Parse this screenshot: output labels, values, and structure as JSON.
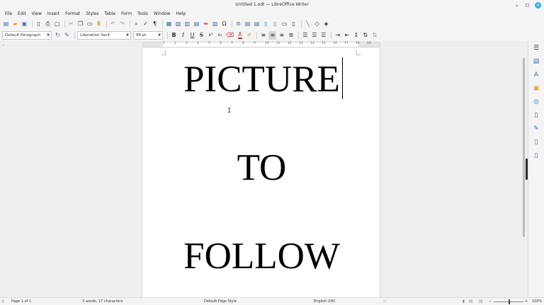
{
  "window": {
    "title": "Untitled 1.odt — LibreOffice Writer",
    "minimize": "⌄",
    "maximize": "◻",
    "close": "✕"
  },
  "menu": [
    "File",
    "Edit",
    "View",
    "Insert",
    "Format",
    "Styles",
    "Table",
    "Form",
    "Tools",
    "Window",
    "Help"
  ],
  "toolbar": {
    "paragraph_style": "Default Paragraph",
    "font_name": "Liberation Serif",
    "font_size": "96 pt",
    "bold": "B",
    "italic": "I",
    "underline": "U",
    "strikethrough": "S",
    "superscript": "x²",
    "subscript": "x₂",
    "font_color": "A"
  },
  "ruler": {
    "numbers": [
      "1",
      "2",
      "3",
      "4",
      "5",
      "6",
      "7",
      "8",
      "9",
      "10",
      "11",
      "12",
      "13",
      "14",
      "15",
      "16",
      "17",
      "18",
      "19"
    ]
  },
  "document": {
    "lines": [
      "PICTURE",
      "TO",
      "FOLLOW"
    ]
  },
  "status": {
    "page": "Page 1 of 1",
    "word_count": "3 words, 17 characters",
    "page_style": "Default Page Style",
    "language": "English (UK)",
    "zoom_minus": "−",
    "zoom_plus": "+",
    "zoom": "100%"
  },
  "colors": {
    "accent": "#3daee9",
    "icon_blue": "#4a6fa5",
    "page": "#ffffff",
    "workspace": "#efefef"
  }
}
